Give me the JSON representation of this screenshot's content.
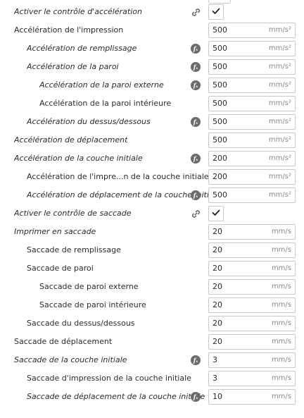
{
  "settings": [
    {
      "label": "Activer le contrôle d'accélération",
      "type": "checkbox",
      "checked": true,
      "indent": 0,
      "italic": true,
      "icon": "link-icon"
    },
    {
      "label": "Accélération de l'impression",
      "type": "number",
      "value": "500",
      "unit": "mm/s²",
      "indent": 0,
      "italic": false,
      "icon": null
    },
    {
      "label": "Accélération de remplissage",
      "type": "number",
      "value": "500",
      "unit": "mm/s²",
      "indent": 1,
      "italic": true,
      "icon": "function-icon"
    },
    {
      "label": "Accélération de la paroi",
      "type": "number",
      "value": "500",
      "unit": "mm/s²",
      "indent": 1,
      "italic": true,
      "icon": "function-icon"
    },
    {
      "label": "Accélération de la paroi externe",
      "type": "number",
      "value": "500",
      "unit": "mm/s²",
      "indent": 2,
      "italic": true,
      "icon": "function-icon"
    },
    {
      "label": "Accélération de la paroi intérieure",
      "type": "number",
      "value": "500",
      "unit": "mm/s²",
      "indent": 2,
      "italic": false,
      "icon": null
    },
    {
      "label": "Accélération du dessus/dessous",
      "type": "number",
      "value": "500",
      "unit": "mm/s²",
      "indent": 1,
      "italic": true,
      "icon": "function-icon"
    },
    {
      "label": "Accélération de déplacement",
      "type": "number",
      "value": "500",
      "unit": "mm/s²",
      "indent": 0,
      "italic": true,
      "icon": null
    },
    {
      "label": "Accélération de la couche initiale",
      "type": "number",
      "value": "200",
      "unit": "mm/s²",
      "indent": 0,
      "italic": true,
      "icon": "function-icon"
    },
    {
      "label": "Accélération de l'impre...n de la couche initiale",
      "type": "number",
      "value": "200",
      "unit": "mm/s²",
      "indent": 1,
      "italic": false,
      "icon": null
    },
    {
      "label": "Accélération de déplacement de la couche initiale",
      "type": "number",
      "value": "500",
      "unit": "mm/s²",
      "indent": 1,
      "italic": true,
      "icon": "function-icon"
    },
    {
      "label": "Activer le contrôle de saccade",
      "type": "checkbox",
      "checked": true,
      "indent": 0,
      "italic": true,
      "icon": "link-icon"
    },
    {
      "label": "Imprimer en saccade",
      "type": "number",
      "value": "20",
      "unit": "mm/s",
      "indent": 0,
      "italic": true,
      "icon": null
    },
    {
      "label": "Saccade de remplissage",
      "type": "number",
      "value": "20",
      "unit": "mm/s",
      "indent": 1,
      "italic": false,
      "icon": null
    },
    {
      "label": "Saccade de paroi",
      "type": "number",
      "value": "20",
      "unit": "mm/s",
      "indent": 1,
      "italic": false,
      "icon": null
    },
    {
      "label": "Saccade de paroi externe",
      "type": "number",
      "value": "20",
      "unit": "mm/s",
      "indent": 2,
      "italic": false,
      "icon": null
    },
    {
      "label": "Saccade de paroi intérieure",
      "type": "number",
      "value": "20",
      "unit": "mm/s",
      "indent": 2,
      "italic": false,
      "icon": null
    },
    {
      "label": "Saccade du dessus/dessous",
      "type": "number",
      "value": "20",
      "unit": "mm/s",
      "indent": 1,
      "italic": false,
      "icon": null
    },
    {
      "label": "Saccade de déplacement",
      "type": "number",
      "value": "20",
      "unit": "mm/s",
      "indent": 0,
      "italic": false,
      "icon": null
    },
    {
      "label": "Saccade de la couche initiale",
      "type": "number",
      "value": "3",
      "unit": "mm/s",
      "indent": 0,
      "italic": true,
      "icon": "function-icon"
    },
    {
      "label": "Saccade d'impression de la couche initiale",
      "type": "number",
      "value": "3",
      "unit": "mm/s",
      "indent": 1,
      "italic": false,
      "icon": null
    },
    {
      "label": "Saccade de déplacement de la couche initiale",
      "type": "number",
      "value": "10",
      "unit": "mm/s",
      "indent": 1,
      "italic": true,
      "icon": "function-icon"
    }
  ],
  "colors": {
    "text": "#2b2b2b",
    "unit": "#8a8a8a",
    "border": "#c9c9c9",
    "icon": "#6b6b6b"
  }
}
